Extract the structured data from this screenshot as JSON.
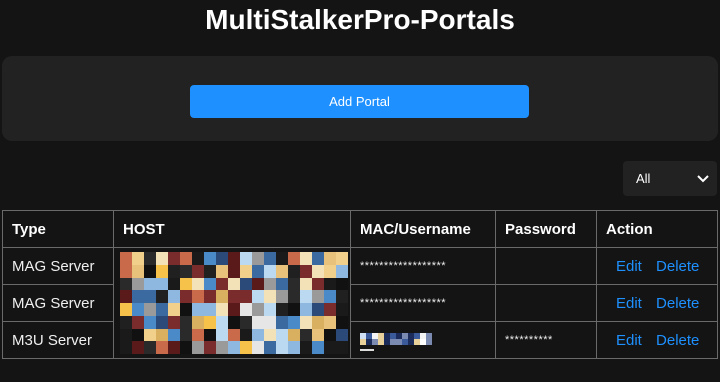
{
  "page": {
    "title": "MultiStalkerPro-Portals"
  },
  "panel": {
    "add_portal_label": "Add Portal"
  },
  "filter": {
    "selected": "All"
  },
  "table": {
    "headers": [
      "Type",
      "HOST",
      "MAC/Username",
      "Password",
      "Action"
    ],
    "rows": [
      {
        "type": "MAG Server",
        "mac": "******************",
        "password": "",
        "edit": "Edit",
        "delete": "Delete"
      },
      {
        "type": "MAG Server",
        "mac": "******************",
        "password": "",
        "edit": "Edit",
        "delete": "Delete"
      },
      {
        "type": "M3U Server",
        "mac": "",
        "password": "**********",
        "edit": "Edit",
        "delete": "Delete"
      }
    ]
  },
  "colors": {
    "accent": "#1e90ff",
    "background": "#141414",
    "panel": "#222222"
  },
  "icons": {
    "filter_chevron": "chevron-down-icon"
  }
}
